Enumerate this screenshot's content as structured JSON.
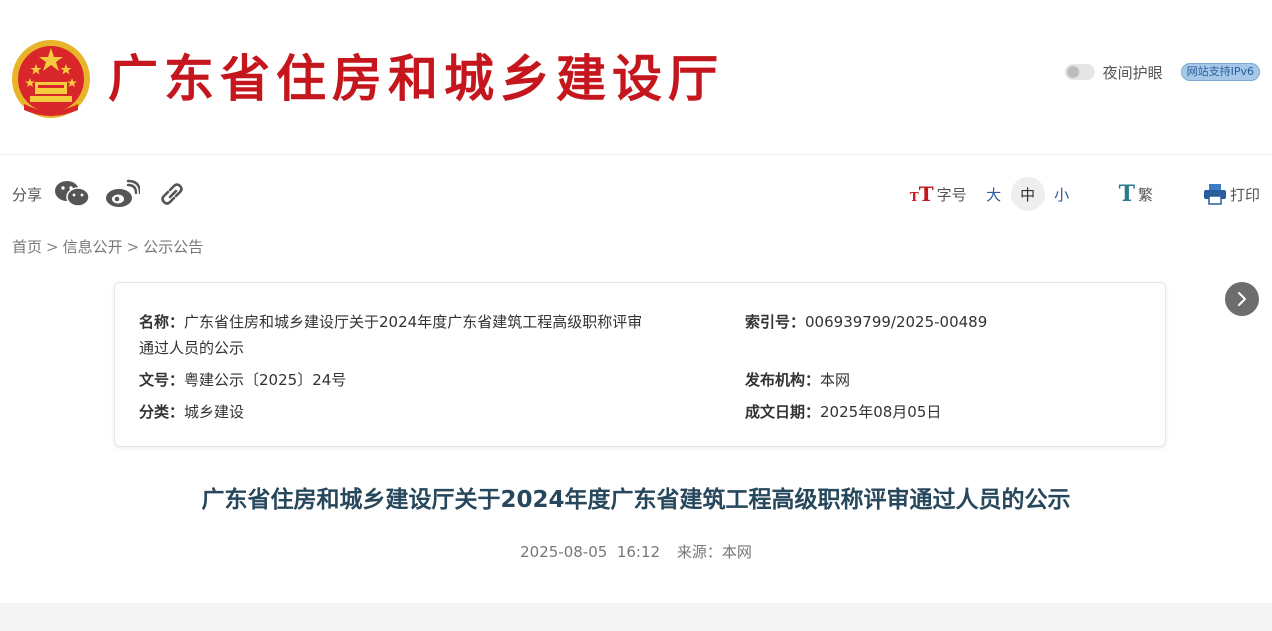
{
  "header": {
    "site_title": "广东省住房和城乡建设厅",
    "night_mode_label": "夜间护眼",
    "ipv6_badge": "网站支持IPv6"
  },
  "toolbar": {
    "share_label": "分享",
    "share_icons": [
      "wechat-icon",
      "weibo-icon",
      "link-icon"
    ],
    "font_size_label": "字号",
    "font_size_options": [
      "大",
      "中",
      "小"
    ],
    "font_size_selected": "中",
    "traditional_label": "繁",
    "print_label": "打印"
  },
  "breadcrumb": {
    "items": [
      "首页",
      "信息公开",
      "公示公告"
    ],
    "separator": ">"
  },
  "info": {
    "name_key": "名称：",
    "name_val_line1": "广东省住房和城乡建设厅关于2024年度广东省建筑工程高级职称评审",
    "name_val_line2": "通过人员的公示",
    "index_key": "索引号：",
    "index_val": "006939799/2025-00489",
    "doc_no_key": "文号：",
    "doc_no_val": "粤建公示〔2025〕24号",
    "publisher_key": "发布机构：",
    "publisher_val": "本网",
    "category_key": "分类：",
    "category_val": "城乡建设",
    "date_key": "成文日期：",
    "date_val": "2025年08月05日"
  },
  "article": {
    "title": "广东省住房和城乡建设厅关于2024年度广东省建筑工程高级职称评审通过人员的公示",
    "date": "2025-08-05",
    "time": "16:12",
    "source_label": "来源：",
    "source_val": "本网"
  },
  "colors": {
    "brand_red": "#c4161c",
    "title_color": "#27475c",
    "link_blue": "#2a5d9c"
  }
}
